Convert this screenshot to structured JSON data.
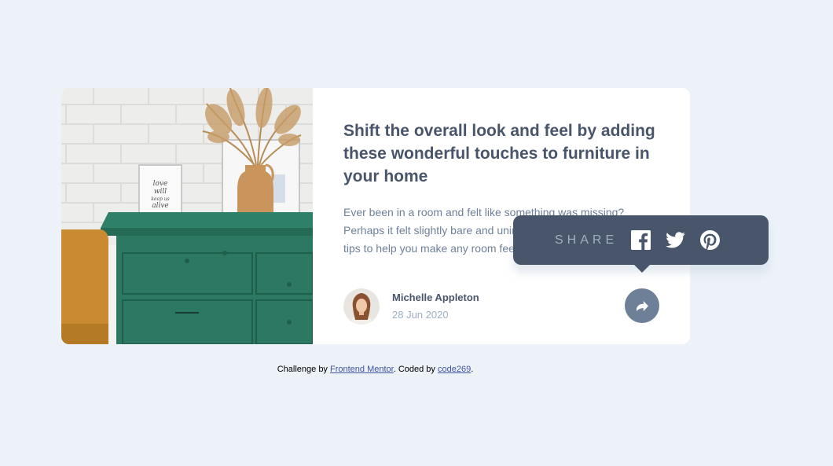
{
  "card": {
    "title": "Shift the overall look and feel by adding these wonderful touches to furniture in your home",
    "excerpt": "Ever been in a room and felt like something was missing? Perhaps it felt slightly bare and uninviting. I’ve got some simple tips to help you make any room feel complete.",
    "author": {
      "name": "Michelle Appleton",
      "date": "28 Jun 2020"
    }
  },
  "share": {
    "label": "SHARE",
    "icons": [
      "facebook-icon",
      "twitter-icon",
      "pinterest-icon"
    ],
    "button_icon": "share-icon"
  },
  "attribution": {
    "prefix": "Challenge by ",
    "link1": "Frontend Mentor",
    "middle": ". Coded by ",
    "link2": "code269",
    "suffix": "."
  },
  "colors": {
    "background": "#ecf2f8",
    "title": "#48556a",
    "body_text": "#6e8098",
    "date": "#9eafc2",
    "popup": "#48556a",
    "share_button": "#6e8098"
  }
}
